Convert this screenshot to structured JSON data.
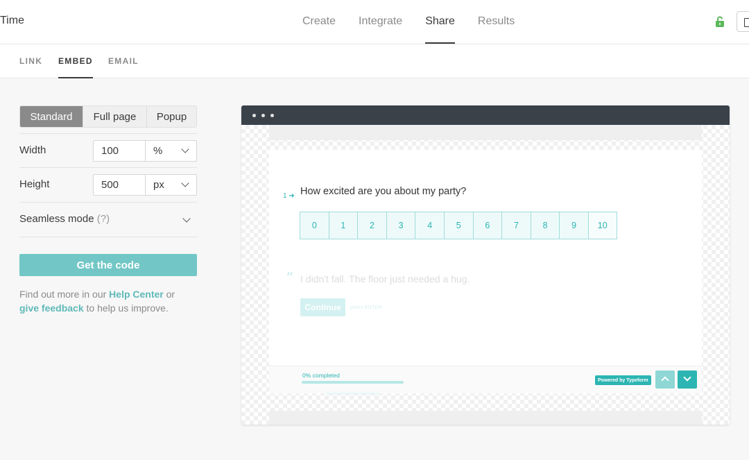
{
  "app": {
    "title": "Time"
  },
  "main_nav": [
    {
      "label": "Create",
      "active": false
    },
    {
      "label": "Integrate",
      "active": false
    },
    {
      "label": "Share",
      "active": true
    },
    {
      "label": "Results",
      "active": false
    }
  ],
  "header_icons": {
    "lock": "lock-open-icon",
    "window": "window-icon",
    "lock_color": "#5cb85c"
  },
  "sub_nav": [
    {
      "label": "LINK",
      "active": false
    },
    {
      "label": "EMBED",
      "active": true
    },
    {
      "label": "EMAIL",
      "active": false
    }
  ],
  "embed_modes": [
    {
      "label": "Standard",
      "active": true
    },
    {
      "label": "Full page",
      "active": false
    },
    {
      "label": "Popup",
      "active": false
    }
  ],
  "width": {
    "label": "Width",
    "value": "100",
    "unit": "%"
  },
  "height": {
    "label": "Height",
    "value": "500",
    "unit": "px"
  },
  "seamless": {
    "label": "Seamless mode",
    "help": "(?)"
  },
  "get_code_label": "Get the code",
  "help": {
    "prefix": "Find out more in our ",
    "help_center": "Help Center",
    "or": " or",
    "feedback": "give feedback",
    "suffix": " to help us improve."
  },
  "preview": {
    "question_number": "1",
    "question_text": "How excited are you about my party?",
    "scale": [
      "0",
      "1",
      "2",
      "3",
      "4",
      "5",
      "6",
      "7",
      "8",
      "9",
      "10"
    ],
    "quote_mark": "“",
    "quote_text": "I didn't fall. The floor just needed a hug.",
    "continue_label": "Continue",
    "press_hint": "press ENTER",
    "progress_text": "0% completed",
    "progress_fraction": 0,
    "powered_by": "Powered by Typeform"
  },
  "colors": {
    "accent": "#2cb5b2",
    "button": "#72c7c6",
    "link": "#5fb9b8",
    "browser_bar": "#3a4149"
  }
}
